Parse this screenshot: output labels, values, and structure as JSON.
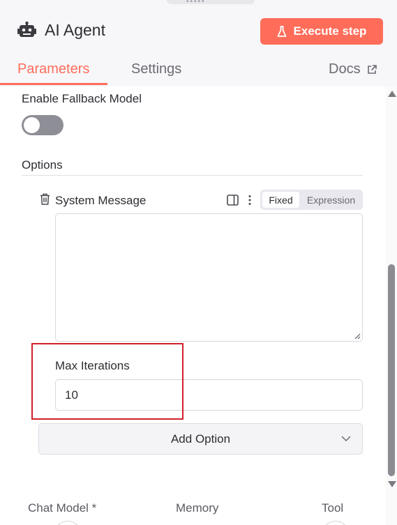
{
  "node": {
    "title": "AI Agent",
    "icon": "robot-icon",
    "execute_label": "Execute step",
    "execute_icon": "flask-icon"
  },
  "tabs": {
    "parameters": "Parameters",
    "settings": "Settings",
    "docs": "Docs",
    "active": "Parameters"
  },
  "fallback": {
    "label": "Enable Fallback Model",
    "enabled": false
  },
  "options": {
    "label": "Options",
    "system_message": {
      "label": "System Message",
      "mode_fixed": "Fixed",
      "mode_expression": "Expression",
      "active_mode": "Fixed",
      "value": ""
    },
    "max_iterations": {
      "label": "Max Iterations",
      "value": "10"
    },
    "add_option_label": "Add Option"
  },
  "connections": {
    "chat_model": "Chat Model *",
    "memory": "Memory",
    "tool": "Tool"
  },
  "colors": {
    "accent": "#ff6d5a",
    "highlight": "#d0202a"
  }
}
